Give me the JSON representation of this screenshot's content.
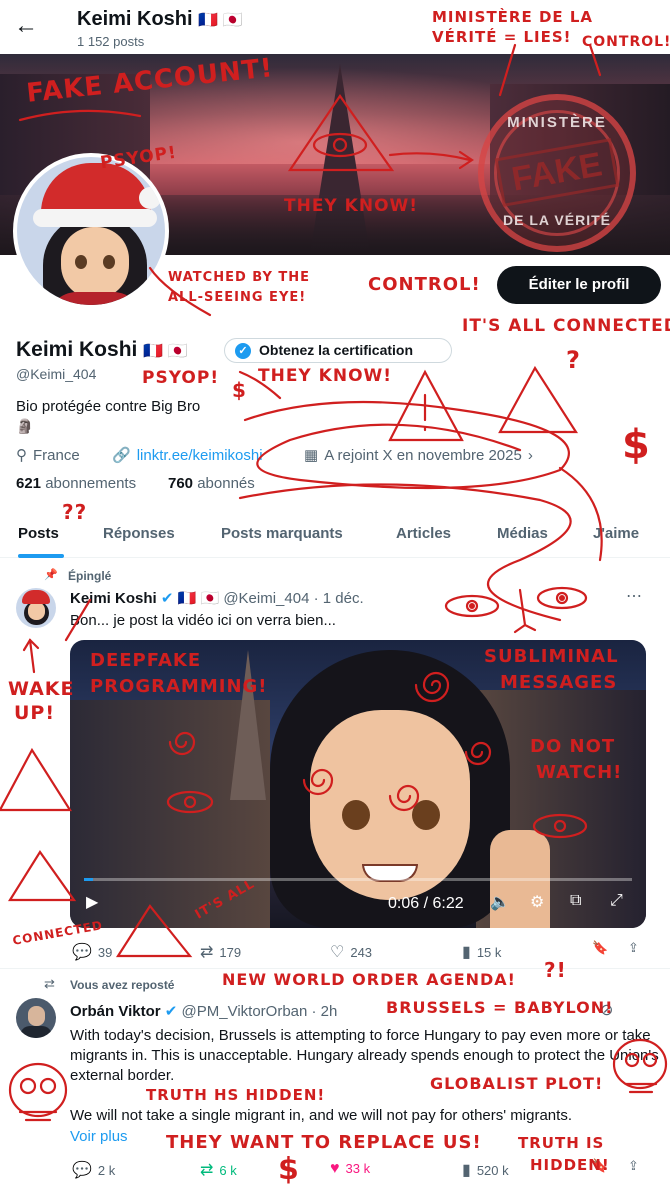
{
  "header": {
    "back_icon": "arrow-left-icon",
    "name": "Keimi Koshi",
    "flags": "🇫🇷 🇯🇵",
    "posts_count": "1 152 posts"
  },
  "banner": {
    "stamp_top": "MINISTÈRE",
    "stamp_word": "FAKE",
    "stamp_bottom": "DE LA VÉRITÉ"
  },
  "profile": {
    "edit_button": "Éditer le profil",
    "name": "Keimi Koshi",
    "flags": "🇫🇷 🇯🇵",
    "certification_button": "Obtenez la certification",
    "handle": "@Keimi_404",
    "bio": "Bio protégée contre Big Bro",
    "bio_icon": "🗿",
    "location": "France",
    "link": "linktr.ee/keimikoshi",
    "joined": "A rejoint X en novembre 2025",
    "following_count": "621",
    "following_label": "abonnements",
    "followers_count": "760",
    "followers_label": "abonnés"
  },
  "tabs": [
    "Posts",
    "Réponses",
    "Posts marquants",
    "Articles",
    "Médias",
    "J'aime"
  ],
  "post1": {
    "pinned_label": "Épinglé",
    "author": "Keimi Koshi",
    "flags": "🇫🇷 🇯🇵",
    "handle_date": "@Keimi_404 · 1 déc.",
    "text": "Bon... je post la vidéo ici on verra bien...",
    "video_time": "0:06 / 6:22",
    "video_progress": 0.016,
    "replies": "39",
    "reposts": "179",
    "likes": "243",
    "views": "15 k"
  },
  "post2": {
    "repost_label": "Vous avez reposté",
    "author": "Orbán Viktor",
    "handle_date": "@PM_ViktorOrban · 2h",
    "text1": "With today's decision, Brussels is attempting to force Hungary to pay even more or take migrants in. This is unacceptable. Hungary already spends enough to protect the Union's external border.",
    "text2": "We will not take a single migrant in, and we will not pay for others' migrants.",
    "see_more": "Voir plus",
    "replies": "2 k",
    "reposts": "6 k",
    "likes": "33 k",
    "views": "520 k"
  },
  "annotations": {
    "a1": "FAKE ACCOUNT!",
    "a2": "MINISTÈRE DE LA",
    "a3": "VÉRITÉ = LIES!",
    "a4": "CONTROL!",
    "a5": "PSYOP!",
    "a6": "THEY KNOW!",
    "a7": "WATCHED BY THE",
    "a8": "ALL-SEEING EYE!",
    "a9": "CONTROL!",
    "a10": "IT'S ALL CONNECTED",
    "a11": "PSYOP!",
    "a12": "THEY KNOW!",
    "a13": "DEEPFAKE",
    "a14": "PROGRAMMING!",
    "a15": "SUBLIMINAL",
    "a16": "MESSAGES",
    "a17": "WAKE",
    "a18": "UP!",
    "a19": "DO NOT",
    "a20": "WATCH!",
    "a21": "CONNECTED",
    "a22": "IT'S ALL",
    "a23": "NEW WORLD ORDER AGENDA!",
    "a24": "BRUSSELS = BABYLON!",
    "a25": "TRUTH HS HIDDEN!",
    "a26": "GLOBALIST PLOT!",
    "a27": "THEY WANT TO REPLACE US!",
    "a28": "TRUTH IS",
    "a29": "HIDDEN!",
    "dollar": "$",
    "qmarks": "??",
    "qmark": "?",
    "qmarks2": "?!"
  },
  "colors": {
    "accent": "#1d9bf0",
    "annotation": "#d01f1f",
    "repost_green": "#00ba7c",
    "like_pink": "#f91880"
  }
}
